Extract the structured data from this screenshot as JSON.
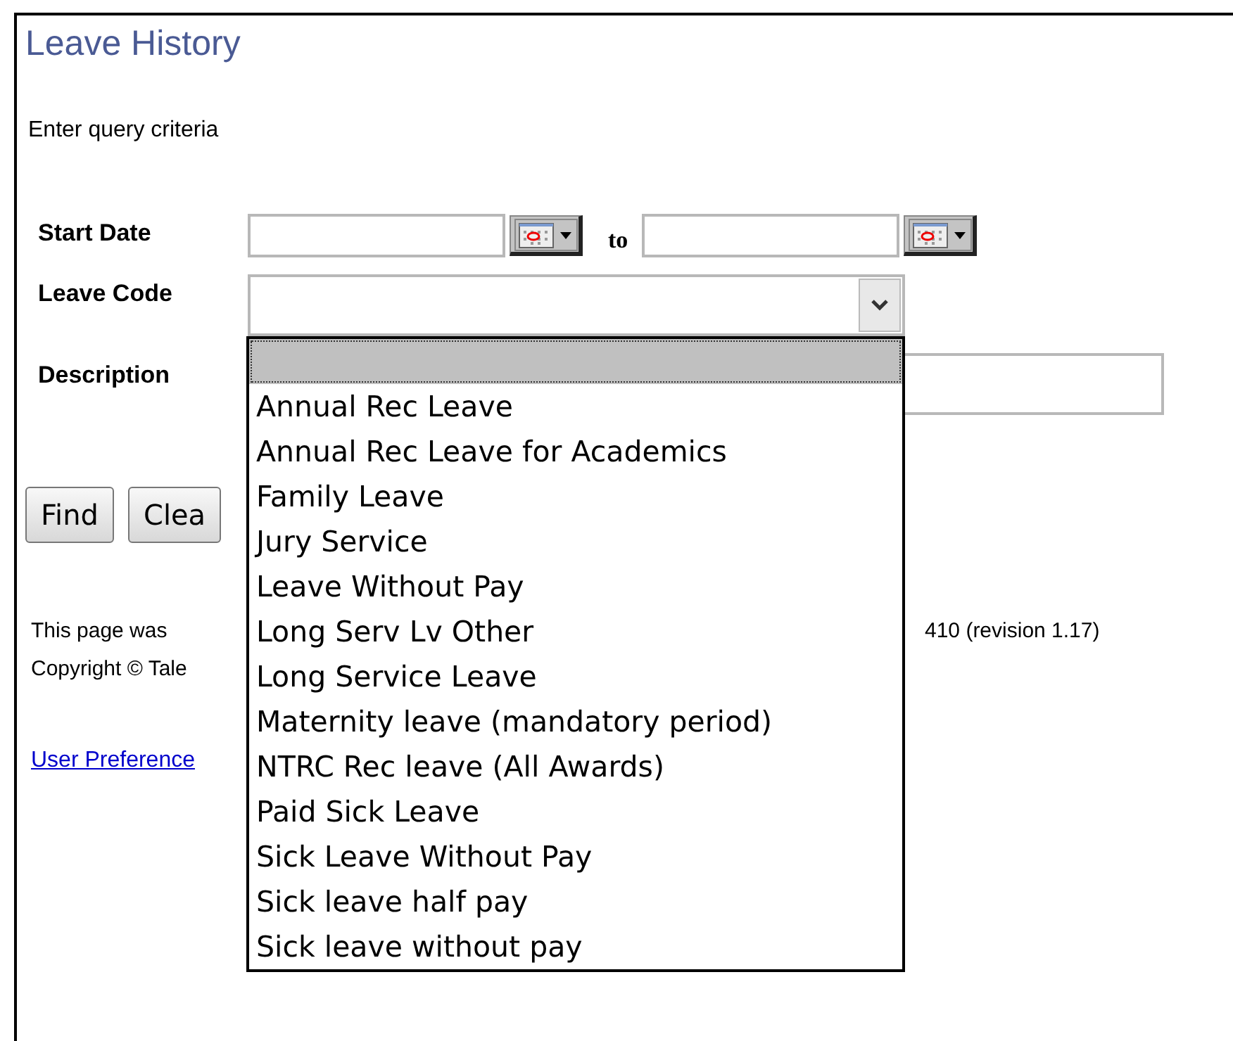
{
  "title": "Leave History",
  "instruction": "Enter query criteria",
  "fields": [
    {
      "kind": "date_range",
      "label": "Start Date",
      "separator": "to"
    },
    {
      "kind": "select",
      "label": "Leave Code"
    },
    {
      "kind": "text",
      "label": "Description"
    }
  ],
  "buttons": [
    "Find",
    "Clea"
  ],
  "leave_code_list": {
    "expanded": true,
    "options": [
      {
        "selected": true
      },
      {
        "label": "Annual Rec Leave",
        "selected": false
      },
      {
        "label": "Annual Rec Leave for Academics",
        "selected": false
      },
      {
        "label": "Family Leave",
        "selected": false
      },
      {
        "label": "Jury Service",
        "selected": false
      },
      {
        "label": "Leave Without Pay",
        "selected": false
      },
      {
        "label": "Long Serv Lv Other",
        "selected": false
      },
      {
        "label": "Long Service Leave",
        "selected": false
      },
      {
        "label": "Maternity leave (mandatory period)",
        "selected": false
      },
      {
        "label": "NTRC Rec leave (All Awards)",
        "selected": false
      },
      {
        "label": "Paid Sick Leave",
        "selected": false
      },
      {
        "label": "Sick Leave Without Pay",
        "selected": false
      },
      {
        "label": "Sick leave half pay",
        "selected": false
      },
      {
        "label": "Sick leave without pay",
        "selected": false
      }
    ]
  },
  "footer": {
    "lines": [
      {
        "left": "This page was",
        "right": "410 (revision 1.17)"
      },
      {
        "left": "Copyright © Tale"
      }
    ],
    "link": "User Preference"
  }
}
